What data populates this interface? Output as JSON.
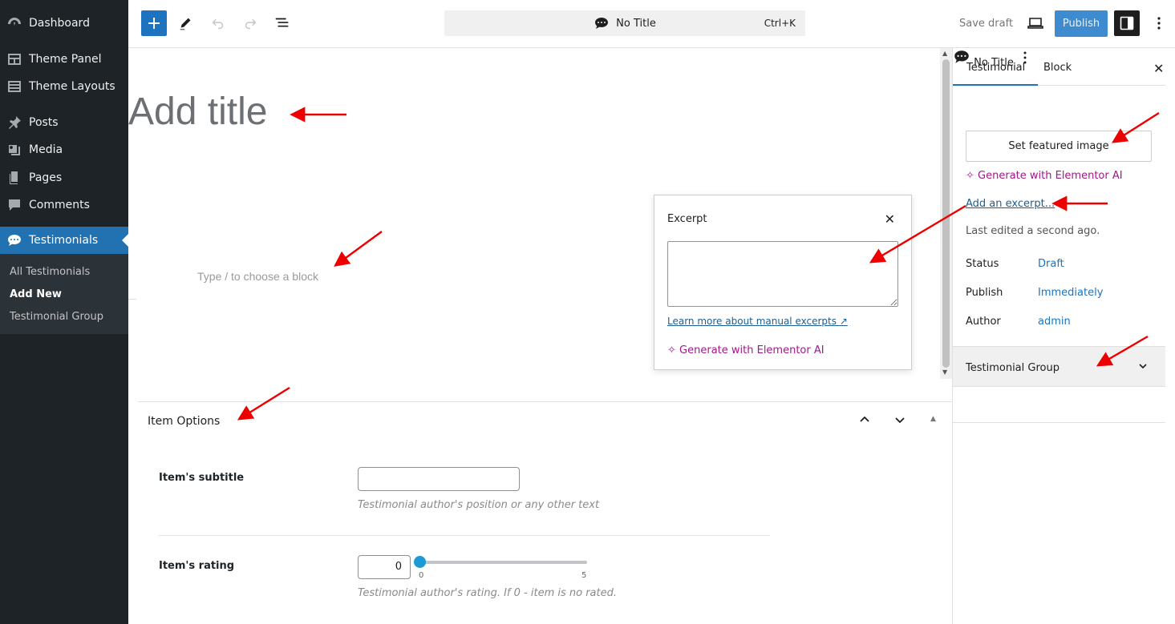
{
  "admin_menu": {
    "items": [
      {
        "label": "Dashboard",
        "icon": "dashboard-icon"
      },
      {
        "label": "Theme Panel",
        "icon": "theme-panel-icon"
      },
      {
        "label": "Theme Layouts",
        "icon": "theme-layouts-icon"
      },
      {
        "label": "Posts",
        "icon": "pin-icon"
      },
      {
        "label": "Media",
        "icon": "media-icon"
      },
      {
        "label": "Pages",
        "icon": "pages-icon"
      },
      {
        "label": "Comments",
        "icon": "comment-icon"
      },
      {
        "label": "Testimonials",
        "icon": "testimonial-icon"
      }
    ],
    "submenu": [
      "All Testimonials",
      "Add New",
      "Testimonial Group"
    ],
    "current_sub": "Add New",
    "accent": "#2271b1",
    "bg": "#1d2327"
  },
  "toolbar": {
    "doc_title": "No Title",
    "shortcut": "Ctrl+K",
    "save_draft": "Save draft",
    "publish": "Publish"
  },
  "editor": {
    "title_placeholder": "Add title",
    "block_placeholder": "Type / to choose a block"
  },
  "excerpt_popover": {
    "heading": "Excerpt",
    "learn_more": "Learn more about manual excerpts",
    "generate": "Generate with Elementor AI"
  },
  "item_options": {
    "heading": "Item Options",
    "subtitle_label": "Item's subtitle",
    "subtitle_help": "Testimonial author's position or any other text",
    "rating_label": "Item's rating",
    "rating_value": "0",
    "rating_min": "0",
    "rating_max": "5",
    "rating_help": "Testimonial author's rating. If 0 - item is no rated."
  },
  "settings": {
    "tabs": [
      "Testimonial",
      "Block"
    ],
    "post_title": "No Title",
    "featured_image": "Set featured image",
    "generate": "Generate with Elementor AI",
    "add_excerpt": "Add an excerpt...",
    "last_edited": "Last edited a second ago.",
    "status_label": "Status",
    "status_value": "Draft",
    "publish_label": "Publish",
    "publish_value": "Immediately",
    "author_label": "Author",
    "author_value": "admin",
    "group_panel": "Testimonial Group"
  }
}
